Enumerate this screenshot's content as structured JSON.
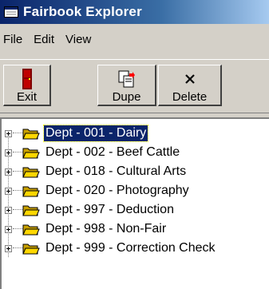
{
  "window": {
    "title": "Fairbook Explorer",
    "title_icon": "window-app-icon"
  },
  "menu": {
    "items": [
      {
        "label": "File"
      },
      {
        "label": "Edit"
      },
      {
        "label": "View"
      }
    ]
  },
  "toolbar": {
    "buttons": [
      {
        "label": "Exit",
        "icon": "door-exit-icon"
      },
      {
        "label": "Dupe",
        "icon": "duplicate-icon"
      },
      {
        "label": "Delete",
        "icon": "delete-x-icon"
      }
    ]
  },
  "tree": {
    "selected_index": 0,
    "items": [
      {
        "label": "Dept - 001 - Dairy"
      },
      {
        "label": "Dept - 002 - Beef Cattle"
      },
      {
        "label": "Dept - 018 - Cultural Arts"
      },
      {
        "label": "Dept - 020 - Photography"
      },
      {
        "label": "Dept - 997 - Deduction"
      },
      {
        "label": "Dept - 998 - Non-Fair"
      },
      {
        "label": "Dept - 999 - Correction Check"
      }
    ]
  },
  "colors": {
    "titlebar_start": "#0a246a",
    "titlebar_end": "#a6caf0",
    "window_face": "#d4d0c8",
    "selection": "#0a246a",
    "folder_yellow": "#ffd700"
  }
}
